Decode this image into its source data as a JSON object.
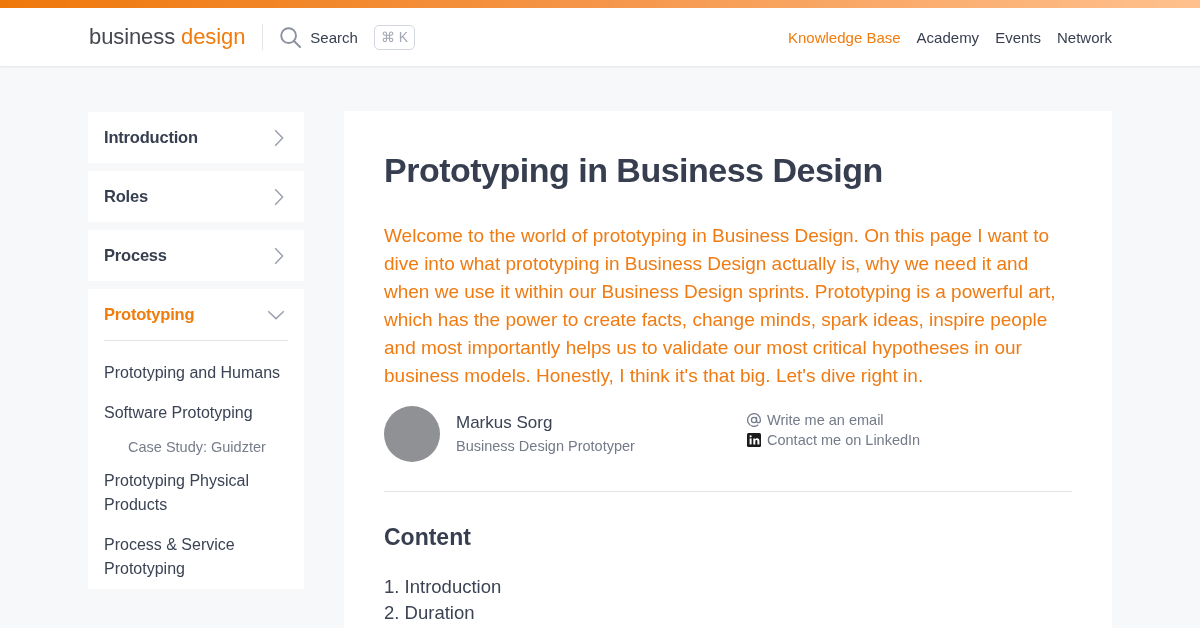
{
  "header": {
    "logo": {
      "text": "business",
      "accent": "design"
    },
    "search": {
      "label": "Search",
      "shortcut": "⌘ K"
    },
    "nav": [
      {
        "label": "Knowledge Base",
        "selected": true
      },
      {
        "label": "Academy",
        "selected": false
      },
      {
        "label": "Events",
        "selected": false
      },
      {
        "label": "Network",
        "selected": false
      }
    ]
  },
  "sidebar": {
    "sections": [
      {
        "label": "Introduction",
        "expanded": false
      },
      {
        "label": "Roles",
        "expanded": false
      },
      {
        "label": "Process",
        "expanded": false
      },
      {
        "label": "Prototyping",
        "expanded": true,
        "children": [
          {
            "label": "Prototyping and Humans"
          },
          {
            "label": "Software Prototyping",
            "children": [
              {
                "label": "Case Study: Guidzter"
              }
            ]
          },
          {
            "label": "Prototyping Physical Products"
          },
          {
            "label": "Process & Service Prototyping"
          }
        ]
      }
    ]
  },
  "article": {
    "title": "Prototyping in Business Design",
    "intro": "Welcome to the world of prototyping in Business Design. On this page I want to dive into what prototyping in Business Design actually is, why we need it and when we use it within our Business Design sprints. Prototyping is a powerful art, which has the power to create facts, change minds, spark ideas, inspire people and most importantly helps us to validate our most critical hypotheses in our business models. Honestly, I think it's that big. Let's dive right in.",
    "author": {
      "name": "Markus Sorg",
      "role": "Business Design Prototyper"
    },
    "contacts": [
      {
        "kind": "email",
        "label": "Write me an email"
      },
      {
        "kind": "linkedin",
        "label": "Contact me on LinkedIn"
      }
    ],
    "contents_heading": "Content",
    "contents": [
      "1. Introduction",
      "2. Duration"
    ]
  }
}
